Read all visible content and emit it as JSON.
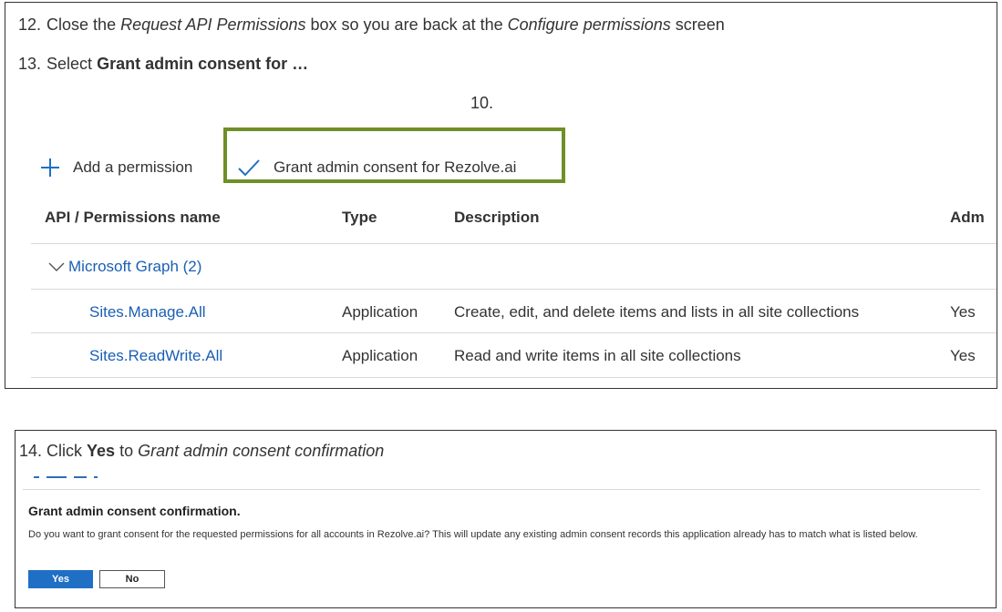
{
  "box1": {
    "step12": {
      "number": "12.",
      "parts": [
        "Close the ",
        "Request API Permissions",
        " box so you are back at the ",
        "Configure permissions",
        " screen"
      ]
    },
    "step13": {
      "number": "13.",
      "prefix": "Select ",
      "bold": "Grant admin consent for …"
    },
    "step10_label": "10.",
    "commands": {
      "add_permission": "Add a permission",
      "grant_consent": "Grant admin consent for Rezolve.ai"
    },
    "icons": {
      "add": "plus-icon",
      "grant": "check-icon",
      "group": "chevron-down-icon"
    },
    "highlight_color": "#6f8f27",
    "table": {
      "headers": [
        "API / Permissions name",
        "Type",
        "Description",
        "Adm"
      ],
      "group_label": "Microsoft Graph (2)",
      "rows": [
        {
          "name": "Sites.Manage.All",
          "type": "Application",
          "description": "Create, edit, and delete items and lists in all site collections",
          "admin": "Yes"
        },
        {
          "name": "Sites.ReadWrite.All",
          "type": "Application",
          "description": "Read and write items in all site collections",
          "admin": "Yes"
        }
      ]
    }
  },
  "box2": {
    "step14": {
      "parts": [
        "14. Click ",
        "Yes",
        " to ",
        "Grant admin consent confirmation"
      ]
    },
    "dialog": {
      "title": "Grant admin consent confirmation.",
      "body": "Do you want to grant consent for the requested permissions for all accounts in Rezolve.ai? This will update any existing admin consent records this application already has to match what is listed below.",
      "yes_label": "Yes",
      "no_label": "No"
    },
    "primary_color": "#1f6fc5"
  }
}
